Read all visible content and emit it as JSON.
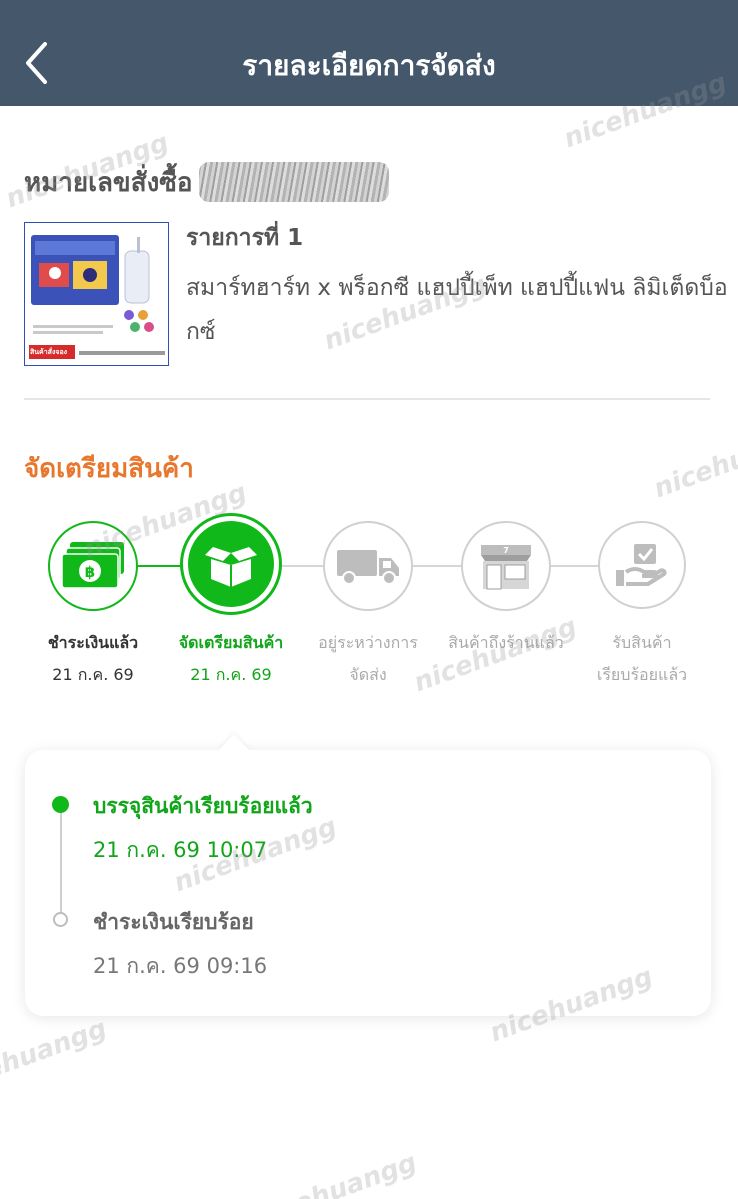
{
  "header": {
    "title": "รายละเอียดการจัดส่ง",
    "back_icon": "chevron-left-icon",
    "background": "#44576b"
  },
  "order": {
    "label": "หมายเลขสั่งซื้อ",
    "item": {
      "number_label": "รายการที่ 1",
      "name": "สมาร์ทฮาร์ท x พร็อกซี แฮปปี้เพ็ท แฮปปี้แฟน ลิมิเต็ดบ็อกซ์",
      "badge": "สินค้าสั่งจอง"
    }
  },
  "status": {
    "heading": "จัดเตรียมสินค้า",
    "heading_color": "#e8772e",
    "active_color": "#11b81a",
    "steps": [
      {
        "label": "ชำระเงินแล้ว",
        "date": "21 ก.ค. 69",
        "icon": "cash-icon",
        "state": "done"
      },
      {
        "label": "จัดเตรียมสินค้า",
        "date": "21 ก.ค. 69",
        "icon": "open-box-icon",
        "state": "current"
      },
      {
        "label": "อยู่ระหว่างการ",
        "label2": "จัดส่ง",
        "icon": "truck-icon",
        "state": "pending"
      },
      {
        "label": "สินค้าถึงร้านแล้ว",
        "icon": "store-icon",
        "state": "pending"
      },
      {
        "label": "รับสินค้า",
        "label2": "เรียบร้อยแล้ว",
        "icon": "hand-package-icon",
        "state": "pending"
      }
    ]
  },
  "timeline": [
    {
      "title": "บรรจุสินค้าเรียบร้อยแล้ว",
      "time": "21 ก.ค. 69 10:07",
      "active": true
    },
    {
      "title": "ชำระเงินเรียบร้อย",
      "time": "21 ก.ค. 69 09:16",
      "active": false
    }
  ],
  "watermark": "nicehuangg"
}
